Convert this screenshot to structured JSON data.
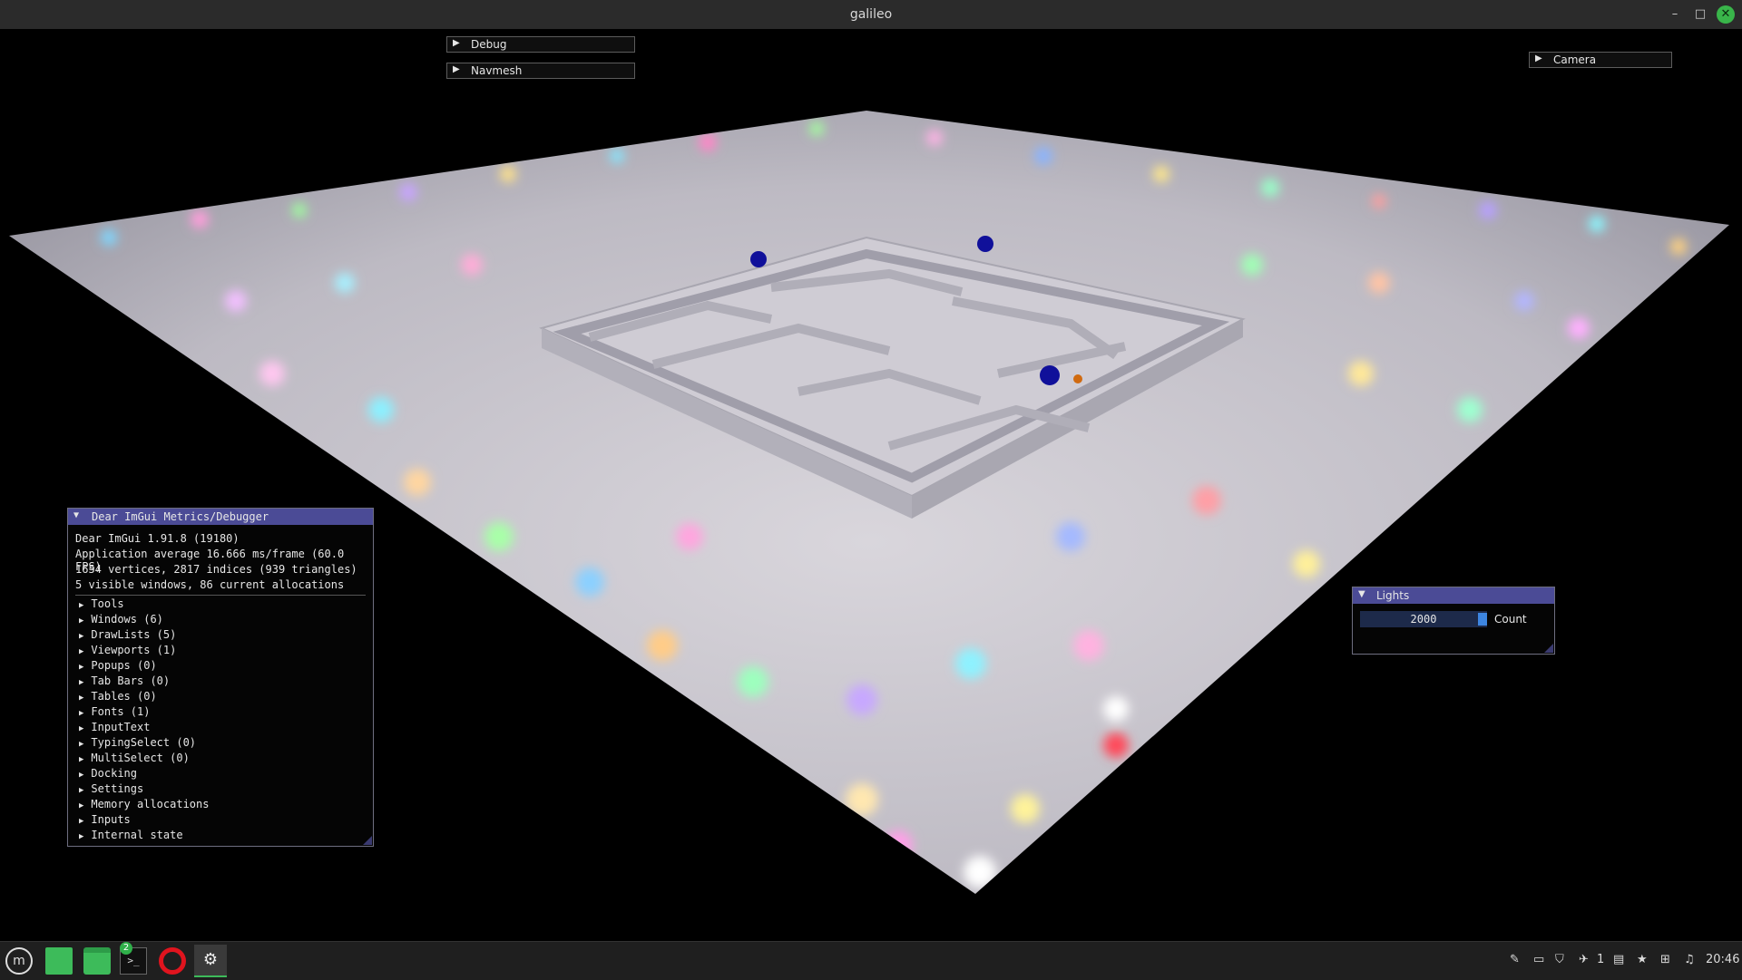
{
  "window": {
    "title": "galileo",
    "controls": {
      "minimize": "–",
      "maximize": "□",
      "close": "✕"
    }
  },
  "imgui_collapsed": {
    "debug": "Debug",
    "navmesh": "Navmesh",
    "camera": "Camera",
    "arrow": "▶"
  },
  "metrics": {
    "title": "Dear ImGui Metrics/Debugger",
    "title_arrow": "▼",
    "lines": [
      "Dear ImGui 1.91.8 (19180)",
      "Application average 16.666 ms/frame (60.0 FPS)",
      "1654 vertices, 2817 indices (939 triangles)",
      "5 visible windows, 86 current allocations"
    ],
    "items": [
      "Tools",
      "Windows (6)",
      "DrawLists (5)",
      "Viewports (1)",
      "Popups (0)",
      "Tab Bars (0)",
      "Tables (0)",
      "Fonts (1)",
      "InputText",
      "TypingSelect (0)",
      "MultiSelect (0)",
      "Docking",
      "Settings",
      "Memory allocations",
      "Inputs",
      "Internal state"
    ]
  },
  "lights": {
    "title": "Lights",
    "title_arrow": "▼",
    "count_value": "2000",
    "count_label": "Count"
  },
  "taskbar": {
    "badge": "2",
    "workspace": "1",
    "clock": "20:46"
  },
  "colors": {
    "imgui_title_active": "#4b4b96",
    "accent_green": "#39b54a",
    "slider_grab": "#3d85e0"
  }
}
